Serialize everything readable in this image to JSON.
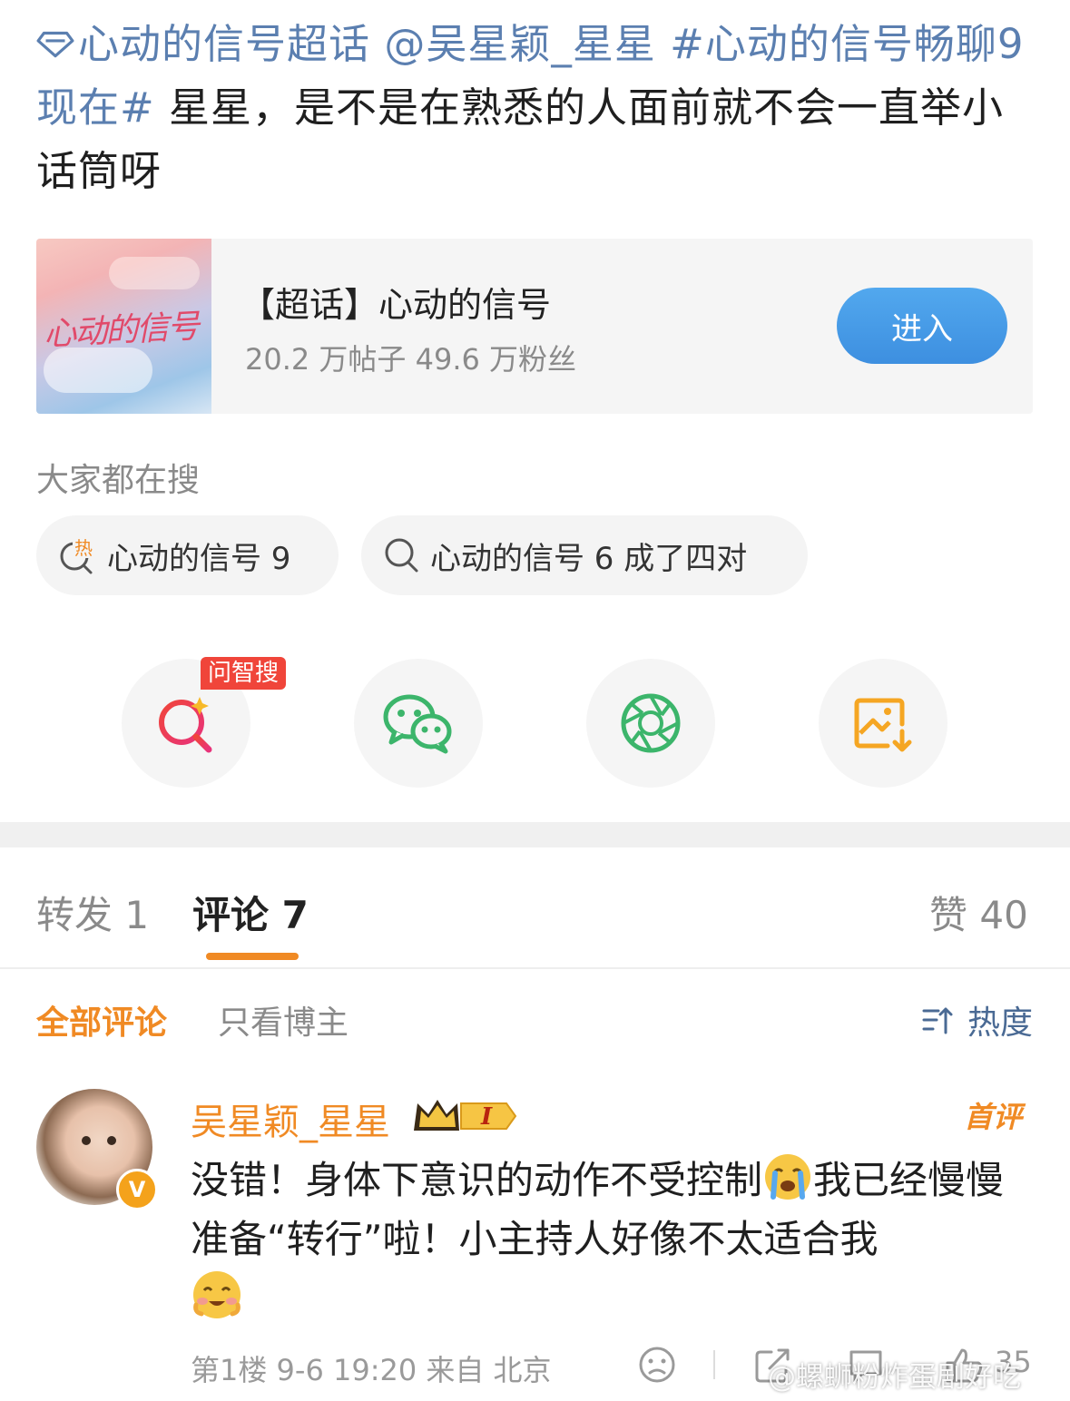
{
  "post": {
    "topic_link": "心动的信号超话",
    "mention": "@吴星颖_星星",
    "hashtag": "#心动的信号畅聊9现在#",
    "body": " 星星，是不是在熟悉的人面前就不会一直举小话筒呀"
  },
  "super_topic_card": {
    "image_text": "心动的信号",
    "title": "【超话】心动的信号",
    "stats": "20.2 万帖子 49.6 万粉丝",
    "enter_label": "进入"
  },
  "search": {
    "title": "大家都在搜",
    "hot_icon_text": "热",
    "chips": [
      "心动的信号 9",
      "心动的信号 6 成了四对"
    ]
  },
  "share": {
    "badge": "问智搜",
    "icons": [
      "ai-search-icon",
      "wechat-icon",
      "moments-icon",
      "save-image-icon"
    ]
  },
  "tabs": {
    "repost": "转发 1",
    "comments": "评论 7",
    "likes": "赞 40"
  },
  "filters": {
    "all": "全部评论",
    "author_only": "只看博主",
    "sort": "热度"
  },
  "comment": {
    "username": "吴星颖_星星",
    "level_badge": "I",
    "verified_badge": "V",
    "first_badge": "首评",
    "text_part1": "没错！身体下意识的动作不受控制",
    "text_part2": "我已经慢慢准备“转行”啦！小主持人好像不太适合我",
    "meta": "第1楼 9-6 19:20 来自 北京",
    "likes": "35"
  },
  "watermark": "@螺蛳粉炸蛋剧好吃",
  "colors": {
    "link": "#5b7fb0",
    "accent_orange": "#f08a24",
    "enter_button": "#3d8fe0",
    "hot_badge": "#f0453a"
  }
}
